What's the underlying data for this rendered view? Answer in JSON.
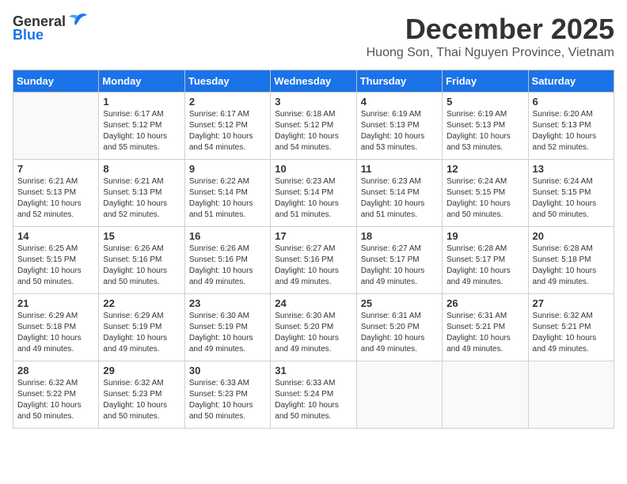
{
  "logo": {
    "general": "General",
    "blue": "Blue"
  },
  "title": "December 2025",
  "subtitle": "Huong Son, Thai Nguyen Province, Vietnam",
  "headers": [
    "Sunday",
    "Monday",
    "Tuesday",
    "Wednesday",
    "Thursday",
    "Friday",
    "Saturday"
  ],
  "weeks": [
    [
      {
        "day": "",
        "sunrise": "",
        "sunset": "",
        "daylight": ""
      },
      {
        "day": "1",
        "sunrise": "Sunrise: 6:17 AM",
        "sunset": "Sunset: 5:12 PM",
        "daylight": "Daylight: 10 hours and 55 minutes."
      },
      {
        "day": "2",
        "sunrise": "Sunrise: 6:17 AM",
        "sunset": "Sunset: 5:12 PM",
        "daylight": "Daylight: 10 hours and 54 minutes."
      },
      {
        "day": "3",
        "sunrise": "Sunrise: 6:18 AM",
        "sunset": "Sunset: 5:12 PM",
        "daylight": "Daylight: 10 hours and 54 minutes."
      },
      {
        "day": "4",
        "sunrise": "Sunrise: 6:19 AM",
        "sunset": "Sunset: 5:13 PM",
        "daylight": "Daylight: 10 hours and 53 minutes."
      },
      {
        "day": "5",
        "sunrise": "Sunrise: 6:19 AM",
        "sunset": "Sunset: 5:13 PM",
        "daylight": "Daylight: 10 hours and 53 minutes."
      },
      {
        "day": "6",
        "sunrise": "Sunrise: 6:20 AM",
        "sunset": "Sunset: 5:13 PM",
        "daylight": "Daylight: 10 hours and 52 minutes."
      }
    ],
    [
      {
        "day": "7",
        "sunrise": "Sunrise: 6:21 AM",
        "sunset": "Sunset: 5:13 PM",
        "daylight": "Daylight: 10 hours and 52 minutes."
      },
      {
        "day": "8",
        "sunrise": "Sunrise: 6:21 AM",
        "sunset": "Sunset: 5:13 PM",
        "daylight": "Daylight: 10 hours and 52 minutes."
      },
      {
        "day": "9",
        "sunrise": "Sunrise: 6:22 AM",
        "sunset": "Sunset: 5:14 PM",
        "daylight": "Daylight: 10 hours and 51 minutes."
      },
      {
        "day": "10",
        "sunrise": "Sunrise: 6:23 AM",
        "sunset": "Sunset: 5:14 PM",
        "daylight": "Daylight: 10 hours and 51 minutes."
      },
      {
        "day": "11",
        "sunrise": "Sunrise: 6:23 AM",
        "sunset": "Sunset: 5:14 PM",
        "daylight": "Daylight: 10 hours and 51 minutes."
      },
      {
        "day": "12",
        "sunrise": "Sunrise: 6:24 AM",
        "sunset": "Sunset: 5:15 PM",
        "daylight": "Daylight: 10 hours and 50 minutes."
      },
      {
        "day": "13",
        "sunrise": "Sunrise: 6:24 AM",
        "sunset": "Sunset: 5:15 PM",
        "daylight": "Daylight: 10 hours and 50 minutes."
      }
    ],
    [
      {
        "day": "14",
        "sunrise": "Sunrise: 6:25 AM",
        "sunset": "Sunset: 5:15 PM",
        "daylight": "Daylight: 10 hours and 50 minutes."
      },
      {
        "day": "15",
        "sunrise": "Sunrise: 6:26 AM",
        "sunset": "Sunset: 5:16 PM",
        "daylight": "Daylight: 10 hours and 50 minutes."
      },
      {
        "day": "16",
        "sunrise": "Sunrise: 6:26 AM",
        "sunset": "Sunset: 5:16 PM",
        "daylight": "Daylight: 10 hours and 49 minutes."
      },
      {
        "day": "17",
        "sunrise": "Sunrise: 6:27 AM",
        "sunset": "Sunset: 5:16 PM",
        "daylight": "Daylight: 10 hours and 49 minutes."
      },
      {
        "day": "18",
        "sunrise": "Sunrise: 6:27 AM",
        "sunset": "Sunset: 5:17 PM",
        "daylight": "Daylight: 10 hours and 49 minutes."
      },
      {
        "day": "19",
        "sunrise": "Sunrise: 6:28 AM",
        "sunset": "Sunset: 5:17 PM",
        "daylight": "Daylight: 10 hours and 49 minutes."
      },
      {
        "day": "20",
        "sunrise": "Sunrise: 6:28 AM",
        "sunset": "Sunset: 5:18 PM",
        "daylight": "Daylight: 10 hours and 49 minutes."
      }
    ],
    [
      {
        "day": "21",
        "sunrise": "Sunrise: 6:29 AM",
        "sunset": "Sunset: 5:18 PM",
        "daylight": "Daylight: 10 hours and 49 minutes."
      },
      {
        "day": "22",
        "sunrise": "Sunrise: 6:29 AM",
        "sunset": "Sunset: 5:19 PM",
        "daylight": "Daylight: 10 hours and 49 minutes."
      },
      {
        "day": "23",
        "sunrise": "Sunrise: 6:30 AM",
        "sunset": "Sunset: 5:19 PM",
        "daylight": "Daylight: 10 hours and 49 minutes."
      },
      {
        "day": "24",
        "sunrise": "Sunrise: 6:30 AM",
        "sunset": "Sunset: 5:20 PM",
        "daylight": "Daylight: 10 hours and 49 minutes."
      },
      {
        "day": "25",
        "sunrise": "Sunrise: 6:31 AM",
        "sunset": "Sunset: 5:20 PM",
        "daylight": "Daylight: 10 hours and 49 minutes."
      },
      {
        "day": "26",
        "sunrise": "Sunrise: 6:31 AM",
        "sunset": "Sunset: 5:21 PM",
        "daylight": "Daylight: 10 hours and 49 minutes."
      },
      {
        "day": "27",
        "sunrise": "Sunrise: 6:32 AM",
        "sunset": "Sunset: 5:21 PM",
        "daylight": "Daylight: 10 hours and 49 minutes."
      }
    ],
    [
      {
        "day": "28",
        "sunrise": "Sunrise: 6:32 AM",
        "sunset": "Sunset: 5:22 PM",
        "daylight": "Daylight: 10 hours and 50 minutes."
      },
      {
        "day": "29",
        "sunrise": "Sunrise: 6:32 AM",
        "sunset": "Sunset: 5:23 PM",
        "daylight": "Daylight: 10 hours and 50 minutes."
      },
      {
        "day": "30",
        "sunrise": "Sunrise: 6:33 AM",
        "sunset": "Sunset: 5:23 PM",
        "daylight": "Daylight: 10 hours and 50 minutes."
      },
      {
        "day": "31",
        "sunrise": "Sunrise: 6:33 AM",
        "sunset": "Sunset: 5:24 PM",
        "daylight": "Daylight: 10 hours and 50 minutes."
      },
      {
        "day": "",
        "sunrise": "",
        "sunset": "",
        "daylight": ""
      },
      {
        "day": "",
        "sunrise": "",
        "sunset": "",
        "daylight": ""
      },
      {
        "day": "",
        "sunrise": "",
        "sunset": "",
        "daylight": ""
      }
    ]
  ]
}
